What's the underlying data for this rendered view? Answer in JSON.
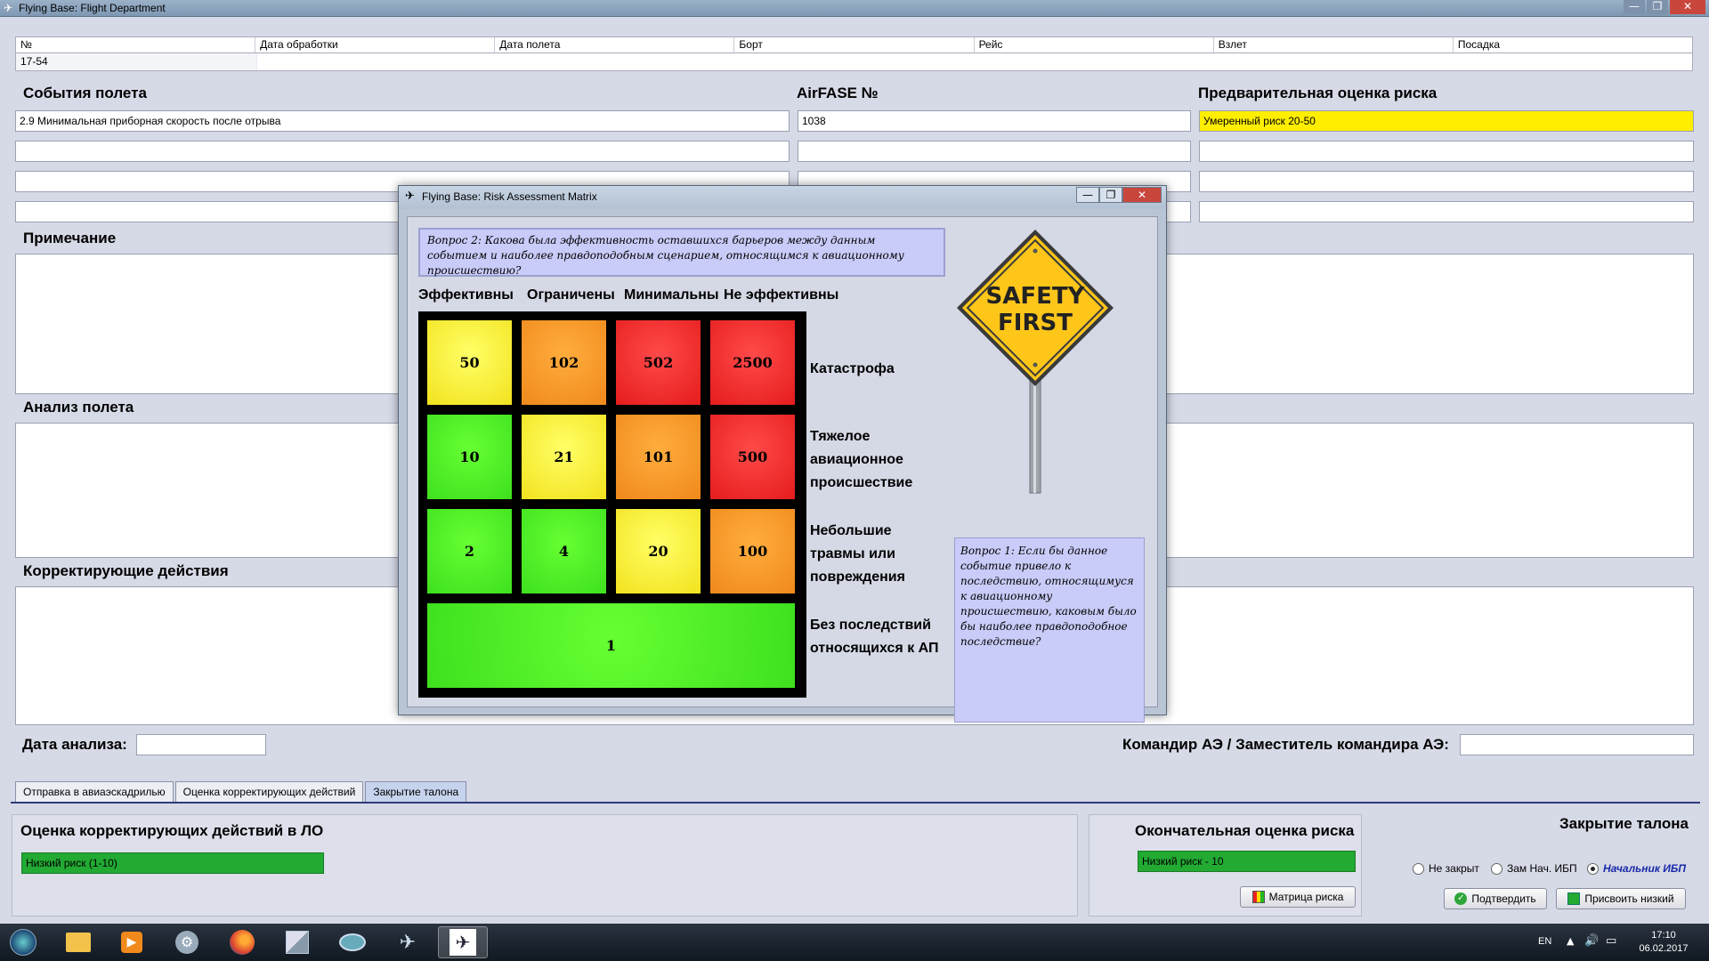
{
  "window": {
    "title": "Flying Base: Flight Department"
  },
  "grid": {
    "headers": [
      "№",
      "Дата обработки",
      "Дата полета",
      "Борт",
      "Рейс",
      "Взлет",
      "Посадка"
    ],
    "row": [
      "17-54"
    ]
  },
  "events": {
    "label": "События полета",
    "values": [
      "2.9 Минимальная приборная скорость после отрыва",
      "",
      "",
      ""
    ]
  },
  "airfase": {
    "label": "AirFASE №",
    "values": [
      "1038",
      "",
      "",
      ""
    ]
  },
  "prelim_risk": {
    "label": "Предварительная оценка риска",
    "values": [
      "Умеренный риск 20-50",
      "",
      "",
      ""
    ],
    "color": "#ffee00"
  },
  "note": {
    "label": "Примечание"
  },
  "analysis": {
    "label": "Анализ полета"
  },
  "corrective": {
    "label": "Корректирующие действия"
  },
  "analysis_date": {
    "label": "Дата анализа:",
    "value": ""
  },
  "commander": {
    "label": "Командир АЭ / Заместитель командира АЭ:",
    "value": ""
  },
  "tabs": [
    "Отправка в авиаэскадрилью",
    "Оценка корректирующих действий",
    "Закрытие талона"
  ],
  "active_tab": "Закрытие талона",
  "bottom": {
    "corrective_eval": {
      "label": "Оценка корректирующих действий в ЛО",
      "value": "Низкий риск   (1-10)"
    },
    "final_risk": {
      "label": "Окончательная оценка риска",
      "value": "Низкий риск - 10",
      "matrix_button": "Матрица риска"
    },
    "closing": {
      "label": "Закрытие талона",
      "options": [
        "Не закрыт",
        "Зам Нач. ИБП",
        "Начальник ИБП"
      ],
      "selected": "Начальник ИБП",
      "confirm_button": "Подтвердить",
      "assign_button": "Присвоить низкий"
    }
  },
  "dialog": {
    "title": "Flying Base: Risk Assessment Matrix",
    "question2": "Вопрос 2: Какова была эффективность оставшихся барьеров между данным событием  и наиболее правдоподобным сценарием, относящимся к авиационному происшествию?",
    "columns": [
      "Эффективны",
      "Ограничены",
      "Минимальны",
      "Не эффективны"
    ],
    "rows": [
      {
        "label": "Катастрофа",
        "values": [
          "50",
          "102",
          "502",
          "2500"
        ],
        "colors": [
          "y",
          "o",
          "r",
          "r"
        ]
      },
      {
        "label": "Тяжелое авиационное происшествие",
        "values": [
          "10",
          "21",
          "101",
          "500"
        ],
        "colors": [
          "g",
          "y",
          "o",
          "r"
        ]
      },
      {
        "label": "Небольшие травмы или повреждения",
        "values": [
          "2",
          "4",
          "20",
          "100"
        ],
        "colors": [
          "g",
          "g",
          "y",
          "o"
        ]
      },
      {
        "label": "Без последствий относящихся к АП",
        "values": [
          "1"
        ],
        "colors": [
          "g"
        ]
      }
    ],
    "sign_text": "SAFETY FIRST",
    "question1": "Вопрос 1: Если бы данное событие  привело к последствию, относящимуся к авиационному происшествию, каковым было бы  наиболее правдоподобное последствие?"
  },
  "taskbar": {
    "lang": "EN",
    "time": "17:10",
    "date": "06.02.2017"
  }
}
